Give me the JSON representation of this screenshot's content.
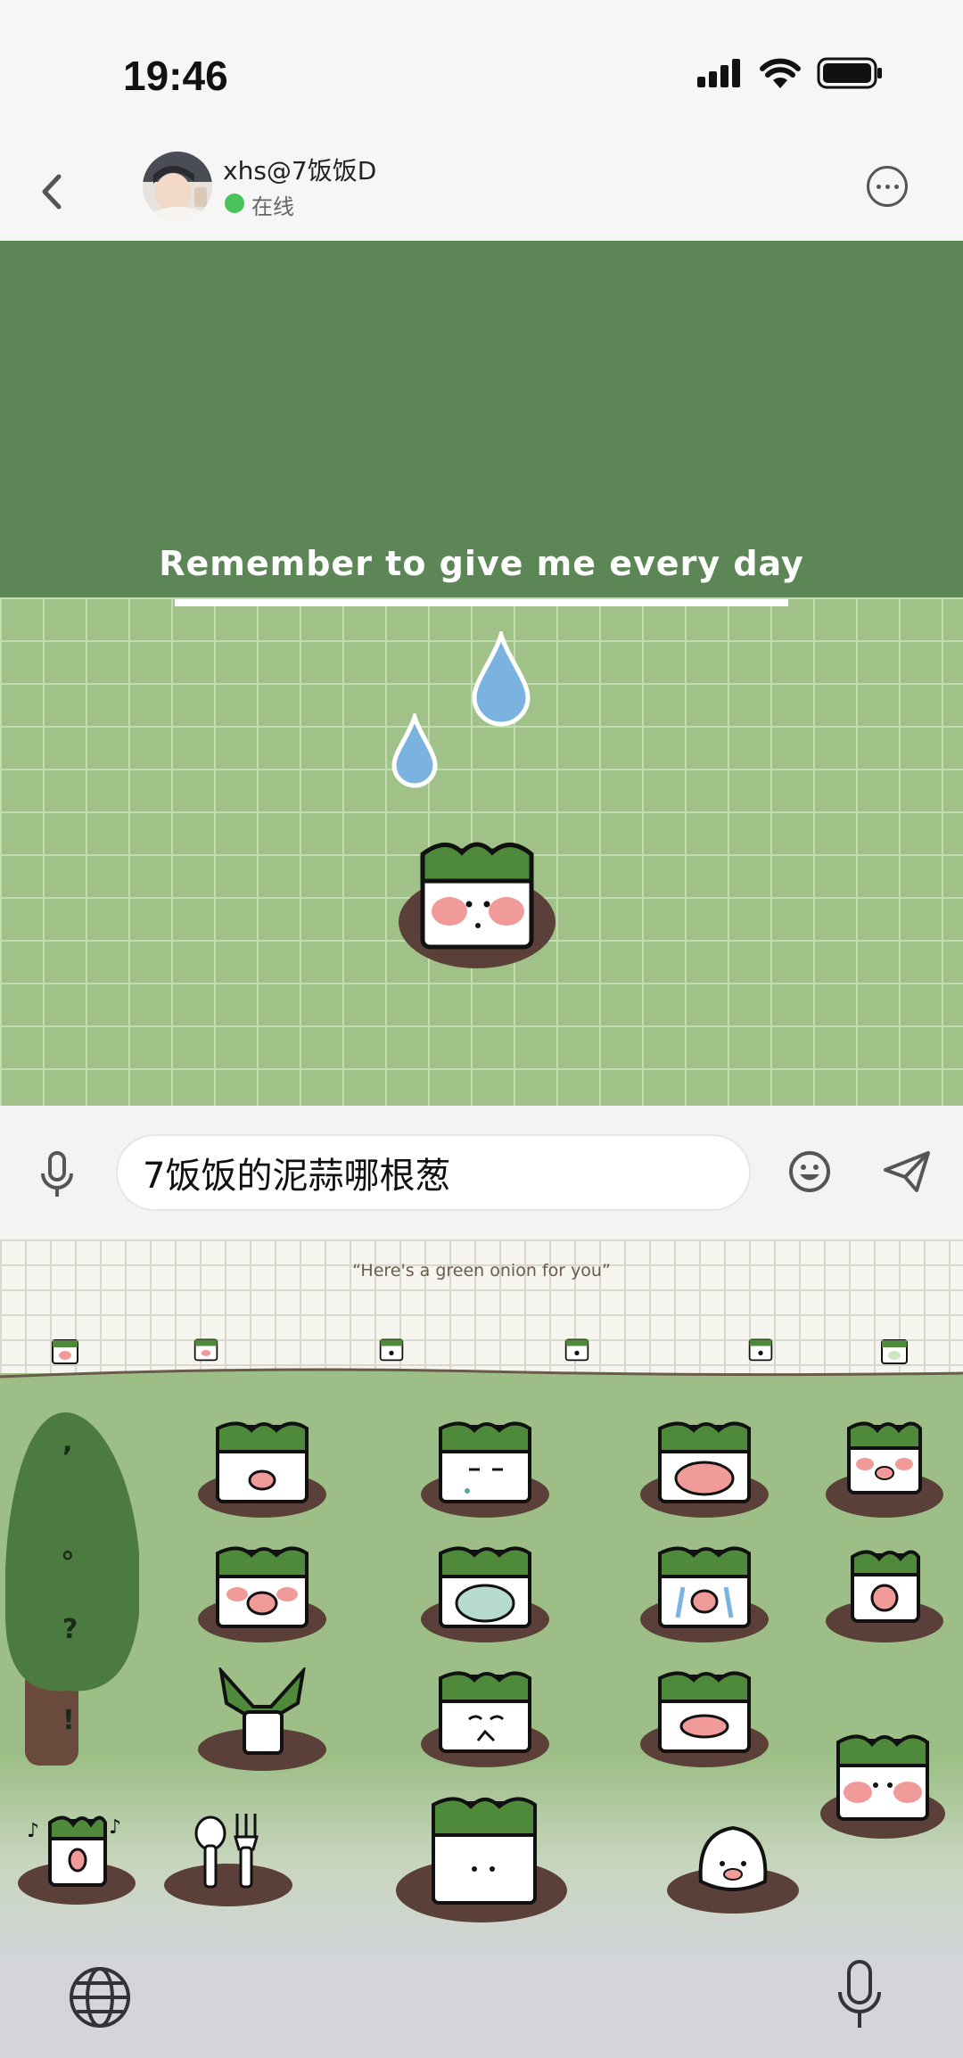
{
  "status_bar": {
    "time": "19:46"
  },
  "chat_header": {
    "contact_name": "xhs@7饭饭D",
    "status": "在线"
  },
  "wallpaper": {
    "banner_text": "Remember to give me every day"
  },
  "input_bar": {
    "message_value": "7饭饭的泥蒜哪根葱"
  },
  "keyboard": {
    "caption": "“Here's a green onion for you”",
    "punctuation": [
      ",",
      "。",
      "?",
      "!"
    ]
  },
  "colors": {
    "header_green": "#5c8655",
    "grid_green": "#a0c288",
    "onion_green": "#4f8a3a",
    "blush": "#f19a9a",
    "water_blue": "#7ab3e0",
    "online_green": "#4cc25c"
  },
  "icons": [
    "back-icon",
    "more-icon",
    "signal-icon",
    "wifi-icon",
    "battery-icon",
    "microphone-icon",
    "emoji-icon",
    "send-icon",
    "globe-icon"
  ]
}
